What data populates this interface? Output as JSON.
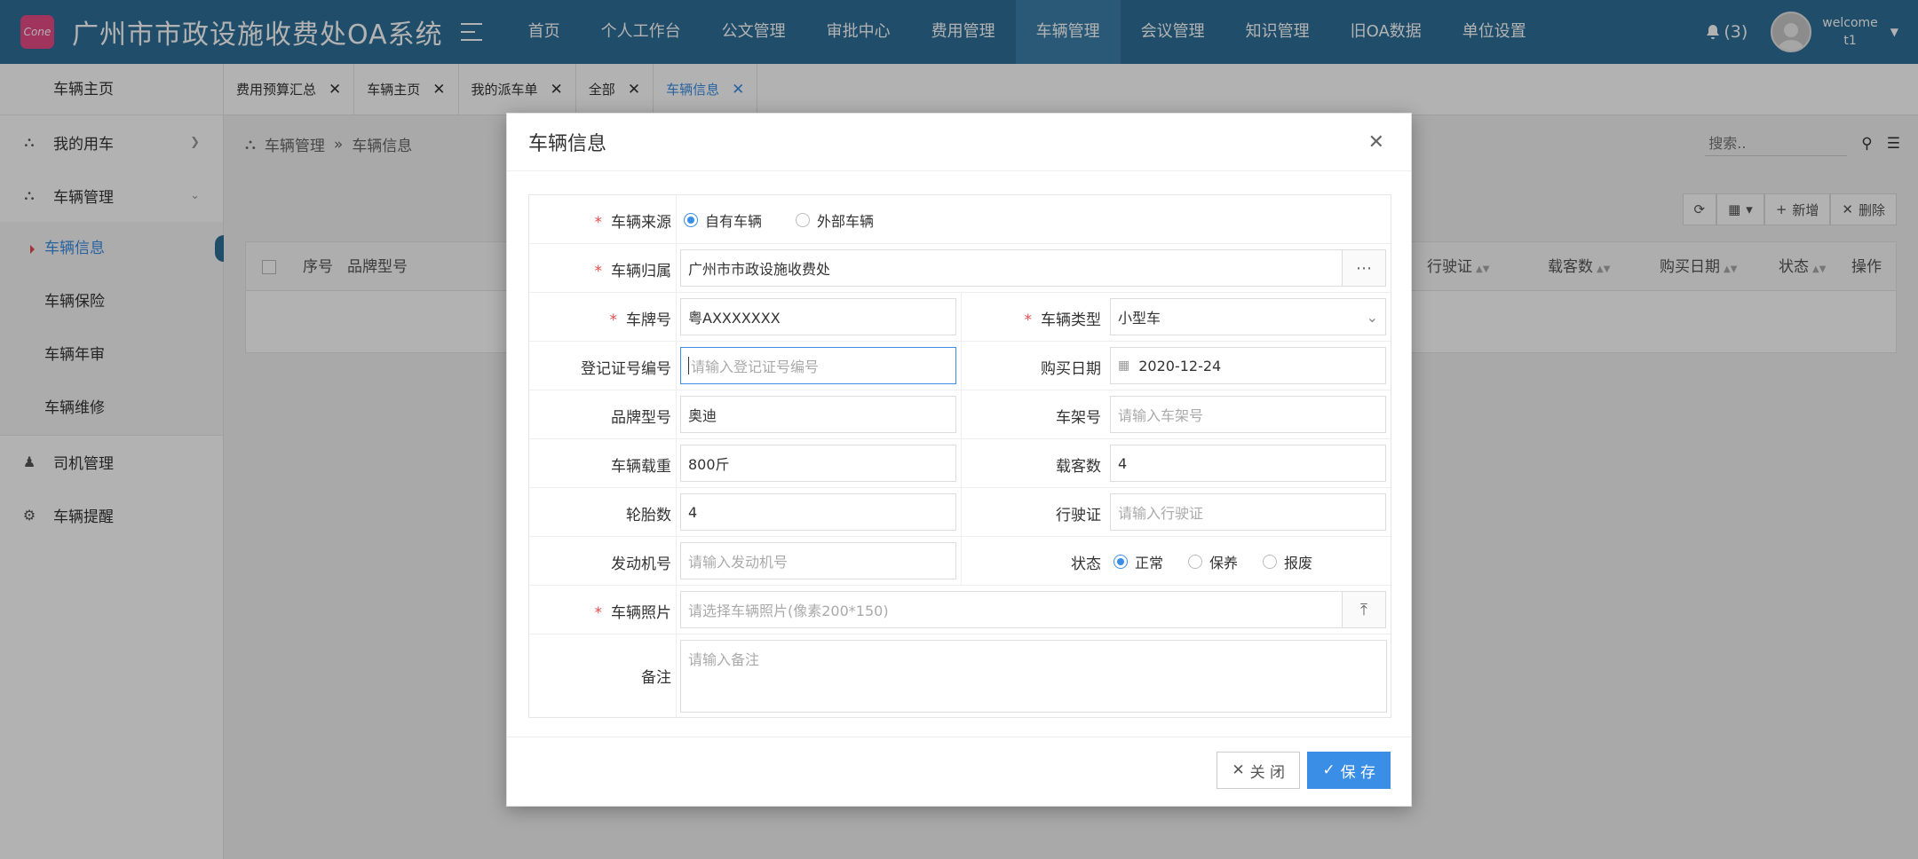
{
  "app": {
    "title": "广州市市政设施收费处OA系统",
    "logo_text": "Cone"
  },
  "nav": [
    "首页",
    "个人工作台",
    "公文管理",
    "审批中心",
    "费用管理",
    "车辆管理",
    "会议管理",
    "知识管理",
    "旧OA数据",
    "单位设置"
  ],
  "nav_active_index": 5,
  "header": {
    "notifications": "(3)",
    "welcome": "welcome",
    "username": "t1"
  },
  "sidebar": {
    "home": "车辆主页",
    "items": [
      {
        "label": "我的用车",
        "icon": "car-icon"
      },
      {
        "label": "车辆管理",
        "icon": "car-icon"
      }
    ],
    "sub_items": [
      "车辆信息",
      "车辆保险",
      "车辆年审",
      "车辆维修"
    ],
    "bottom_items": [
      {
        "label": "司机管理",
        "icon": "user-icon"
      },
      {
        "label": "车辆提醒",
        "icon": "gear-icon"
      }
    ]
  },
  "tabs": [
    "费用预算汇总",
    "车辆主页",
    "我的派车单",
    "全部",
    "车辆信息"
  ],
  "content": {
    "breadcrumb": [
      "车辆管理",
      "车辆信息"
    ],
    "search_placeholder": "搜索..",
    "toolbar": {
      "add": "新增",
      "delete": "删除"
    },
    "columns": {
      "index": "序号",
      "brand": "品牌型号",
      "license": "行驶证",
      "passengers": "载客数",
      "purchase": "购买日期",
      "status": "状态",
      "ops": "操作"
    }
  },
  "dialog": {
    "title": "车辆信息",
    "source_label": "车辆来源",
    "source_options": [
      "自有车辆",
      "外部车辆"
    ],
    "owner_label": "车辆归属",
    "owner_value": "广州市市政设施收费处",
    "plate_label": "车牌号",
    "plate_value": "粤AXXXXXXX",
    "type_label": "车辆类型",
    "type_value": "小型车",
    "reg_label": "登记证号编号",
    "reg_placeholder": "请输入登记证号编号",
    "purchase_label": "购买日期",
    "purchase_value": "2020-12-24",
    "brand_label": "品牌型号",
    "brand_value": "奥迪",
    "frame_label": "车架号",
    "frame_placeholder": "请输入车架号",
    "load_label": "车辆载重",
    "load_value": "800斤",
    "seats_label": "载客数",
    "seats_value": "4",
    "tires_label": "轮胎数",
    "tires_value": "4",
    "license_label": "行驶证",
    "license_placeholder": "请输入行驶证",
    "engine_label": "发动机号",
    "engine_placeholder": "请输入发动机号",
    "status_label": "状态",
    "status_options": [
      "正常",
      "保养",
      "报废"
    ],
    "photo_label": "车辆照片",
    "photo_placeholder": "请选择车辆照片(像素200*150)",
    "remark_label": "备注",
    "remark_placeholder": "请输入备注",
    "close_button": "关 闭",
    "save_button": "保 存"
  },
  "colors": {
    "topbar": "#2f6f99",
    "accent": "#3a8ee6",
    "required": "#e64b4b"
  }
}
